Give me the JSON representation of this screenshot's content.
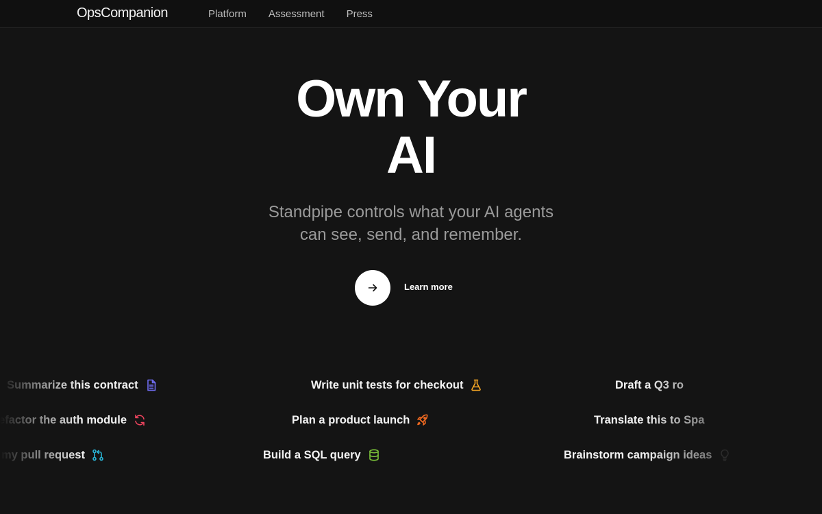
{
  "nav": {
    "logo": "OpsCompanion",
    "links": [
      "Platform",
      "Assessment",
      "Press"
    ]
  },
  "hero": {
    "title_line1": "Own Your",
    "title_line2": "AI",
    "subtitle_line1": "Standpipe controls what your AI agents",
    "subtitle_line2": "can see, send, and remember.",
    "cta_label": "Learn more",
    "cta_icon": "arrow-right-icon"
  },
  "prompts": {
    "row1": [
      {
        "text": "Summarize this contract",
        "icon": "document-icon",
        "color": "#6f6cf0"
      },
      {
        "text": "Write unit tests for checkout",
        "icon": "flask-icon",
        "color": "#f5a524"
      },
      {
        "text": "Draft a Q3 ro",
        "icon": "",
        "color": ""
      }
    ],
    "row2": [
      {
        "text": "efactor the auth module",
        "icon": "refresh-icon",
        "color": "#f0445f"
      },
      {
        "text": "Plan a product launch",
        "icon": "rocket-icon",
        "color": "#f36b21"
      },
      {
        "text": "Translate this to Spa",
        "icon": "",
        "color": ""
      }
    ],
    "row3": [
      {
        "text": "my pull request",
        "icon": "git-pull-request-icon",
        "color": "#29b6d8"
      },
      {
        "text": "Build a SQL query",
        "icon": "database-icon",
        "color": "#7cc33a"
      },
      {
        "text": "Brainstorm campaign ideas",
        "icon": "lightbulb-icon",
        "color": "#5a5a5a"
      }
    ]
  }
}
